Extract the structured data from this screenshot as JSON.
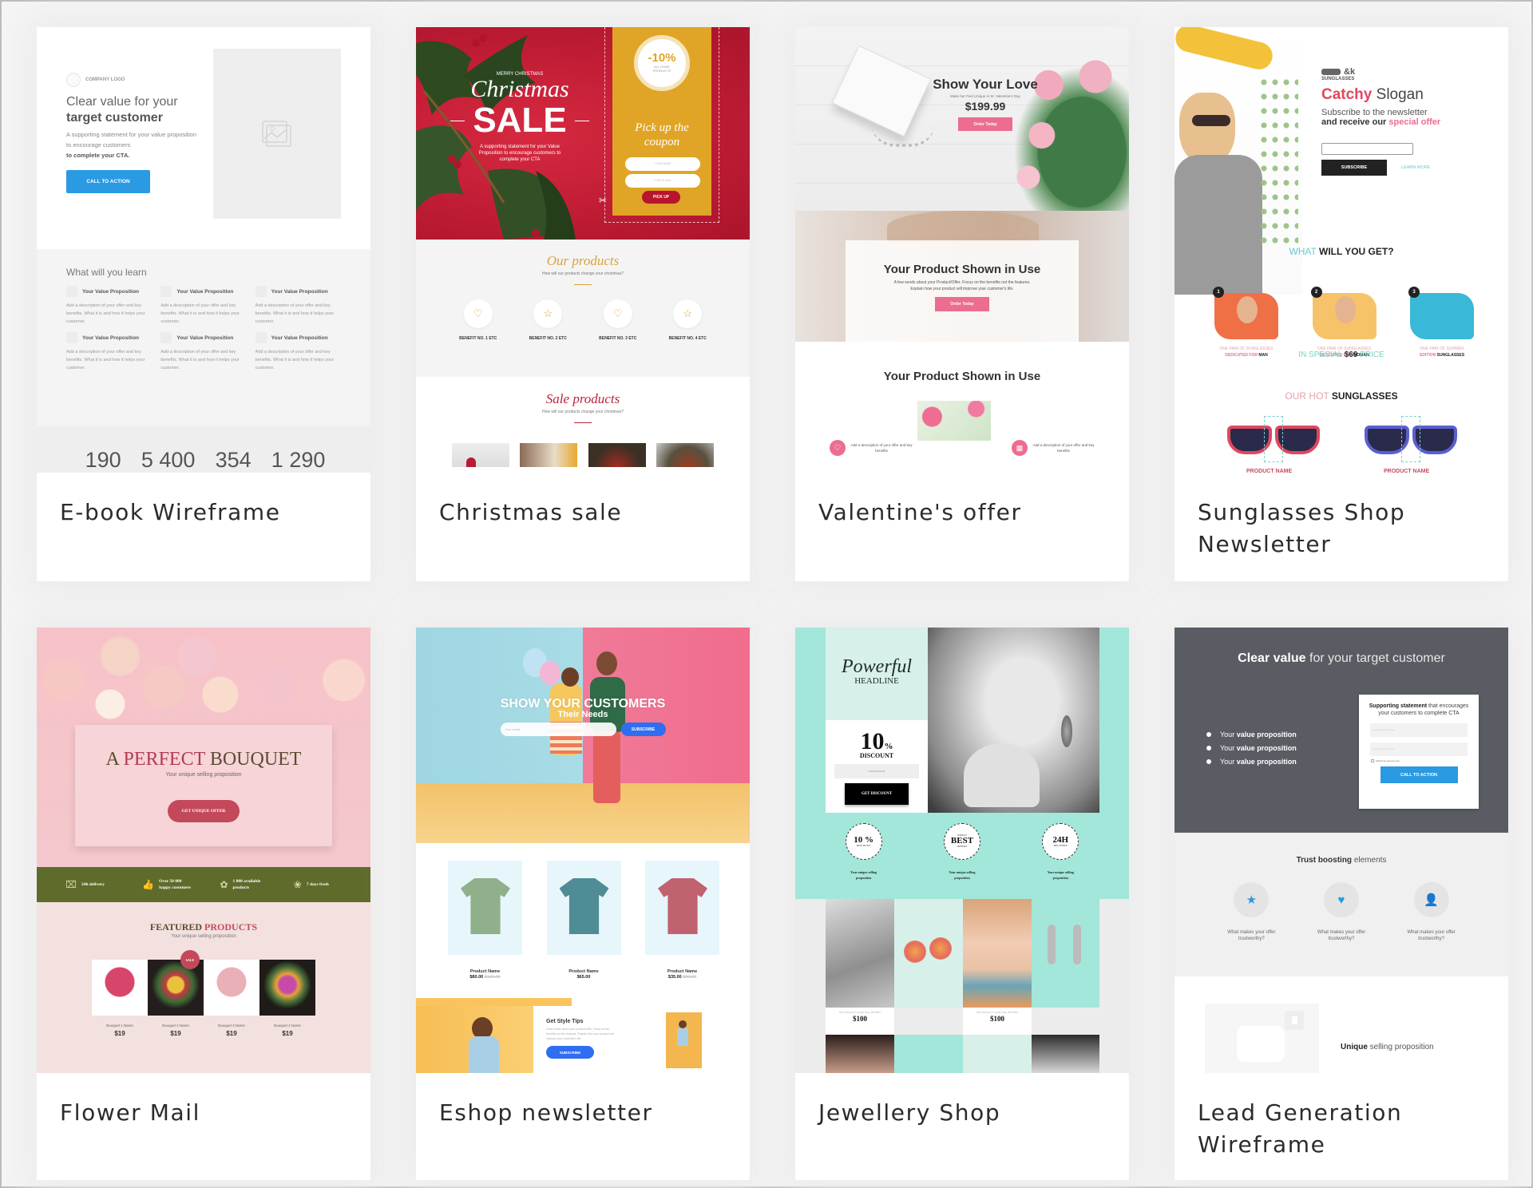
{
  "cards": [
    {
      "title": "E-book Wireframe",
      "preview": {
        "logo": "COMPANY LOGO",
        "headline_light": "Clear value for your",
        "headline_bold": "target customer",
        "support_light": "A supporting statement for your value proposition to encourage customers",
        "support_bold": "to complete your CTA.",
        "cta": "CALL TO ACTION",
        "learn_title": "What will you learn",
        "value_title": "Your Value Proposition",
        "value_desc": "Add a description of your offer and key benefits. What it is and how it helps your customer.",
        "stats": [
          "190",
          "5 400",
          "354",
          "1 290"
        ]
      }
    },
    {
      "title": "Christmas sale",
      "preview": {
        "kicker": "MERRY CHRISTMAS",
        "script": "Christmas",
        "sale": "SALE",
        "support": "A supporting statement for your Value Proposition to encourage customers to complete your CTA",
        "discount": "-10%",
        "discount_sub": "ALL HOME PRODUCTS",
        "coupon_title": "Pick up the coupon",
        "name_placeholder": "YOUR NAME",
        "email_placeholder": "YOUR E-MAIL",
        "pick_up": "PICK UP",
        "our_products": "Our products",
        "our_products_sub": "How will our products change your christmas?",
        "benefits": [
          "BENEFIT NO. 1 ETC",
          "BENEFIT NO. 2 ETC",
          "BENEFIT NO. 3 ETC",
          "BENEFIT NO. 4 ETC"
        ],
        "benefit_icons": [
          "heart-icon",
          "star-icon",
          "heart-icon",
          "star-icon"
        ],
        "sale_products": "Sale products",
        "sale_products_sub": "How will our products change your christmas?"
      }
    },
    {
      "title": "Valentine's offer",
      "preview": {
        "headline": "Show Your Love",
        "sub": "Make her Feel Unique in St. Valentine's Day",
        "price": "$199.99",
        "order": "Order Today",
        "box_title": "Your Product Shown in Use",
        "box_text": "A few words about your Product/Offer. Focus on the benefits not the features. Explain how your product will improve your customer's life.",
        "section_title": "Your Product Shown in Use",
        "feature_text": "Add a description of your offer and key benefits"
      }
    },
    {
      "title": "Sunglasses Shop Newsletter",
      "preview": {
        "brand": "&k",
        "brand_sub": "SUNGLASSES",
        "slogan_accent": "Catchy",
        "slogan": "Slogan",
        "subscribe_line1": "Subscribe to the newsletter",
        "subscribe_line2_bold": "and receive our",
        "subscribe_line2_accent": "special offer",
        "subscribe": "SUBSCRIBE",
        "learn_more": "LEARN MORE",
        "what_light": "WHAT",
        "what_bold": "WILL YOU GET?",
        "items": [
          {
            "num": "1",
            "line1": "ONE PAIR OF SUNGLASSES",
            "line2a": "DEDICATED FOR",
            "line2b": "MAN"
          },
          {
            "num": "2",
            "line1": "ONE PAIR OF SUNGLASSES",
            "line2a": "DEDICATED FOR",
            "line2b": "WOMAN"
          },
          {
            "num": "3",
            "line1": "ONE PAIR OF SUMMER",
            "line2a": "EDITION",
            "line2b": "SUNGLASSES"
          }
        ],
        "price_light": "IN SPECIAL",
        "price_bold": "$69",
        "price_light2": "PRICE",
        "hot_light": "OUR HOT",
        "hot_bold": "SUNGLASSES",
        "product_name": "PRODUCT NAME"
      }
    },
    {
      "title": "Flower Mail",
      "preview": {
        "headline_a": "A",
        "headline_b": "PERFECT",
        "headline_c": "BOUQUET",
        "usp": "Your unique selling proposition",
        "cta": "GET UNIQUE OFFER",
        "features": [
          "24h delivery",
          "Over 50 000 happy customers",
          "1 000 available products",
          "7 days fresh"
        ],
        "featured_a": "FEATURED",
        "featured_b": "PRODUCTS",
        "featured_sub": "Your unique selling proposition",
        "sale_badge": "SALE",
        "products": [
          {
            "name": "Bouquet 1 Name",
            "price": "$19"
          },
          {
            "name": "Bouquet 2 Name",
            "price": "$19"
          },
          {
            "name": "Bouquet 3 Name",
            "price": "$19"
          },
          {
            "name": "Bouquet 4 Name",
            "price": "$19"
          }
        ]
      }
    },
    {
      "title": "Eshop newsletter",
      "preview": {
        "headline": "SHOW YOUR CUSTOMERS",
        "sub": "Their Needs",
        "email_placeholder": "Your email",
        "subscribe": "SUBSCRIBE",
        "products": [
          {
            "name": "Product Name",
            "price": "$80.00",
            "old": "$100.00",
            "color": "#8fb08a"
          },
          {
            "name": "Product Name",
            "price": "$65.00",
            "old": "",
            "color": "#4f8c96"
          },
          {
            "name": "Product Name",
            "price": "$35.00",
            "old": "$50.00",
            "color": "#c0626f"
          }
        ],
        "tips_title": "Get Style Tips",
        "tips_text": "A few words about your product/offer. Focus on the benefits not the features. Explain how your product will improve your customer's life.",
        "tips_cta": "SUBSCRIBE"
      }
    },
    {
      "title": "Jewellery Shop",
      "preview": {
        "script": "Powerful",
        "headline": "HEADLINE",
        "discount": "10",
        "percent": "%",
        "discount_label": "DISCOUNT",
        "email_placeholder": "YOUR EMAIL",
        "cta": "GET DISCOUNT",
        "badges": [
          {
            "top": "",
            "main": "10 %",
            "bottom": "DISCOUNT"
          },
          {
            "top": "WEEKLY",
            "main": "BEST",
            "bottom": "OFFERS"
          },
          {
            "top": "",
            "main": "24H",
            "bottom": "DELIVERY"
          }
        ],
        "badge_text": "Your unique selling proposition",
        "product_label": "NICE PRODUCT NAME WILL BE HERE",
        "price": "$100"
      }
    },
    {
      "title": "Lead Generation Wireframe",
      "preview": {
        "headline_bold": "Clear value",
        "headline_light": "for your target customer",
        "bullets_light": "Your",
        "bullets_bold": "value proposition",
        "form_bold": "Supporting statement",
        "form_light": "that encourages your customers to complete CTA",
        "field1": "Required information",
        "field2": "Required information",
        "checkbox": "Marketing agreements",
        "cta": "CALL TO ACTION",
        "trust_bold": "Trust boosting",
        "trust_light": "elements",
        "trust_text": "What makes your offer trustworthy?",
        "trust_icons": [
          "star-icon",
          "heart-icon",
          "user-icon"
        ],
        "usp_bold": "Unique",
        "usp_light": "selling proposition"
      }
    }
  ],
  "colors": {
    "xmas_red": "#c41e3a",
    "xmas_gold": "#e0a526",
    "valentine_pink": "#ec6d8f",
    "sunglasses_pink": "#e0475f",
    "flower_green": "#5f6b2a",
    "flower_red": "#c3495a",
    "eshop_blue": "#2f6ef0",
    "jewel_mint": "#a3e6da",
    "lead_dark": "#595d63",
    "wire_blue": "#2a9ae2"
  }
}
